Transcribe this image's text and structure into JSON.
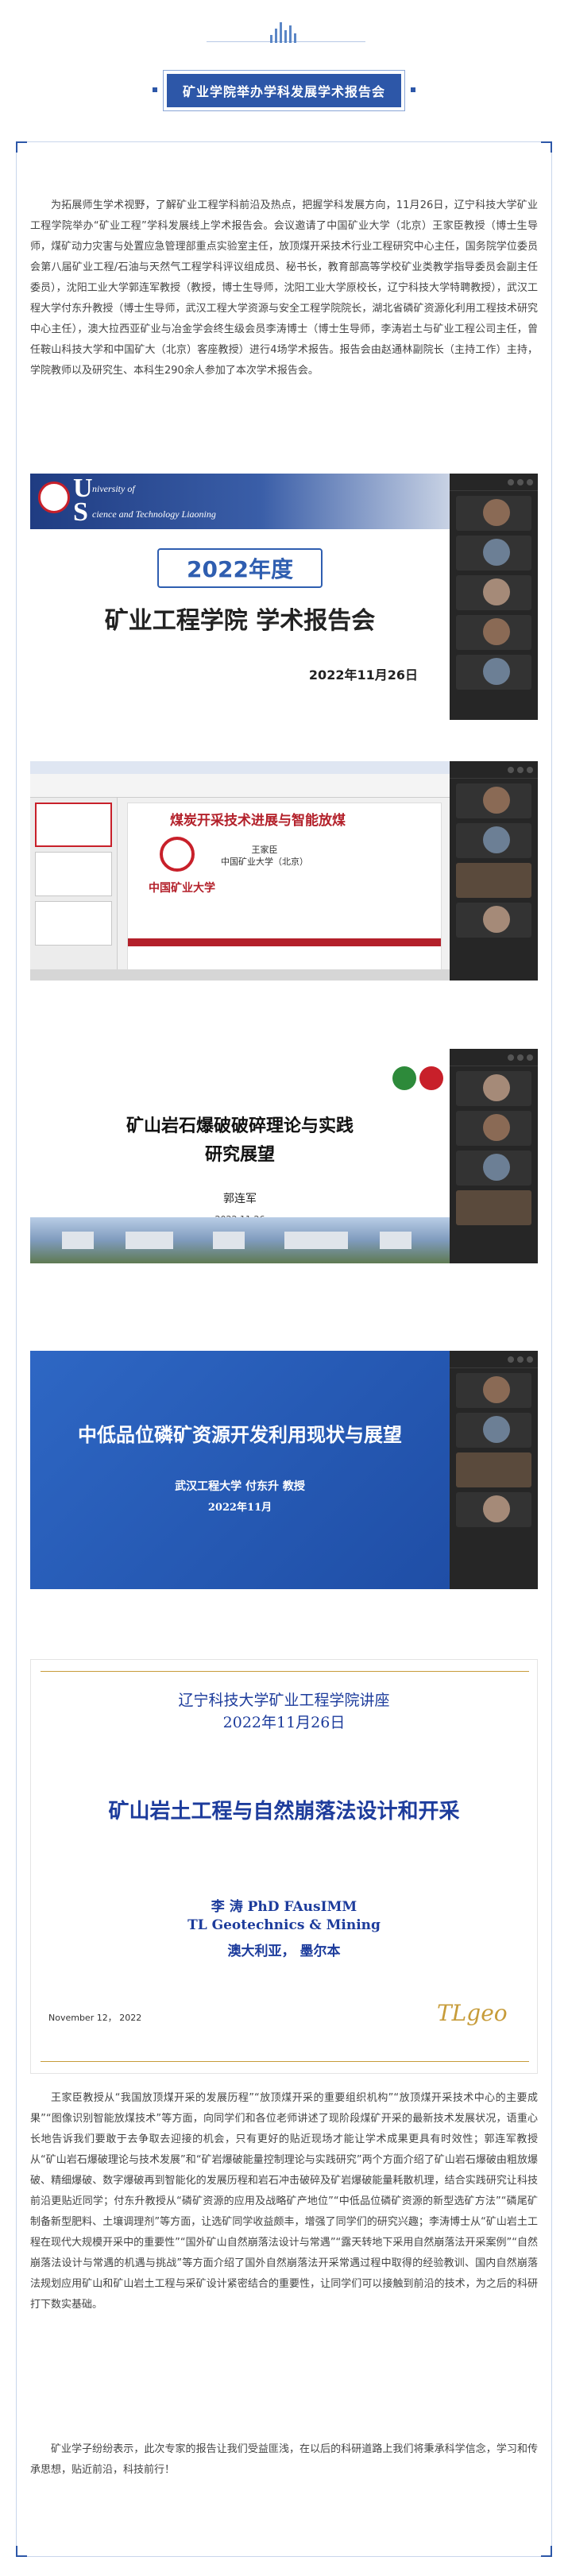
{
  "banner": {
    "title": "矿业学院举办学科发展学术报告会"
  },
  "article": {
    "intro": "为拓展师生学术视野，了解矿业工程学科前沿及热点，把握学科发展方向，11月26日，辽宁科技大学矿业工程学院举办“矿业工程”学科发展线上学术报告会。会议邀请了中国矿业大学（北京）王家臣教授（博士生导师，煤矿动力灾害与处置应急管理部重点实验室主任，放顶煤开采技术行业工程研究中心主任，国务院学位委员会第八届矿业工程/石油与天然气工程学科评议组成员、秘书长，教育部高等学校矿业类教学指导委员会副主任委员），沈阳工业大学郭连军教授（教授，博士生导师，沈阳工业大学原校长，辽宁科技大学特聘教授），武汉工程大学付东升教授（博士生导师，武汉工程大学资源与安全工程学院院长，湖北省磷矿资源化利用工程技术研究中心主任），澳大拉西亚矿业与冶金学会终生级会员李涛博士（博士生导师，李涛岩土与矿业工程公司主任，曾任鞍山科技大学和中国矿大（北京）客座教授）进行4场学术报告。报告会由赵通林副院长（主持工作）主持，学院教师以及研究生、本科生290余人参加了本次学术报告会。",
    "outro": "王家臣教授从“我国放顶煤开采的发展历程”“放顶煤开采的重要组织机构”“放顶煤开采技术中心的主要成果”“图像识别智能放煤技术”等方面，向同学们和各位老师讲述了现阶段煤矿开采的最新技术发展状况，语重心长地告诉我们要敢于去争取去迎接的机会，只有更好的贴近现场才能让学术成果更具有时效性；郭连军教授从“矿山岩石爆破理论与技术发展”和“矿岩爆破能量控制理论与实践研究”两个方面介绍了矿山岩石爆破由粗放爆破、精细爆破、数字爆破再到智能化的发展历程和岩石冲击破碎及矿岩爆破能量耗散机理，结合实践研究让科技前沿更贴近同学；付东升教授从“磷矿资源的应用及战略矿产地位”“中低品位磷矿资源的新型选矿方法”“磷尾矿制备新型肥料、土壤调理剂”等方面，让选矿同学收益颇丰，增强了同学们的研究兴趣；李涛博士从“矿山岩土工程在现代大规模开采中的重要性”“国外矿山自然崩落法设计与常遇”“露天转地下采用自然崩落法开采案例”“自然崩落法设计与常遇的机遇与挑战”等方面介绍了国外自然崩落法开采常遇过程中取得的经验教训、国内自然崩落法规划应用矿山和矿山岩土工程与采矿设计紧密结合的重要性，让同学们可以接触到前沿的技术，为之后的科研打下数实基础。",
    "closing": "矿业学子纷纷表示，此次专家的报告让我们受益匪浅，在以后的科研道路上我们将秉承科学信念，学习和传承思想，贴近前沿，科技前行！"
  },
  "slides": {
    "s1": {
      "univ_line1": "niversity of",
      "univ_line2": "cience and Technology Liaoning",
      "year_badge": "2022年度",
      "title": "矿业工程学院  学术报告会",
      "date": "2022年11月26日"
    },
    "s2": {
      "title": "煤炭开采技术进展与智能放煤",
      "author": "王家臣",
      "affiliation": "中国矿业大学（北京）",
      "logo_text": "中国矿业大学"
    },
    "s3": {
      "title_line1": "矿山岩石爆破破碎理论与实践",
      "title_line2": "研究展望",
      "author": "郭连军",
      "date": "2022.11.26"
    },
    "s4": {
      "title": "中低品位磷矿资源开发利用现状与展望",
      "author": "武汉工程大学    付东升  教授",
      "date": "2022年11月"
    },
    "s5": {
      "header1": "辽宁科技大学矿业工程学院讲座",
      "header2": "2022年11月26日",
      "title": "矿山岩土工程与自然崩落法设计和开采",
      "author1": "李 涛  PhD FAusIMM",
      "author2": "TL Geotechnics & Mining",
      "author3": "澳大利亚，  墨尔本",
      "date": "November 12， 2022",
      "logo": "TLgeo"
    }
  },
  "colors": {
    "banner_blue": "#2d57a8",
    "slide_red": "#b3202a",
    "lecture_blue": "#1d3c9c",
    "gold": "#c79c3a"
  },
  "icons": [
    "bar-chart-decoration-icon",
    "university-logo-icon",
    "participant-avatar-icon",
    "campus-photo"
  ]
}
